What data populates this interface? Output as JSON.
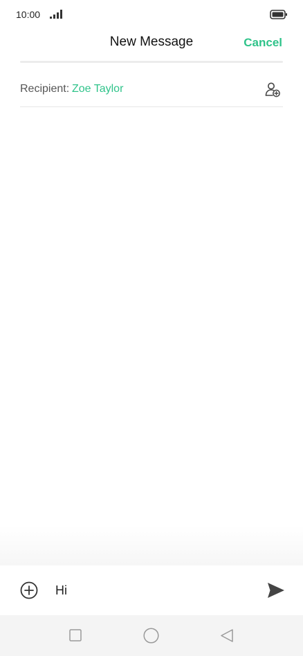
{
  "status_bar": {
    "time": "10:00",
    "signal_icon": "signal-bars-icon",
    "battery_icon": "battery-icon"
  },
  "header": {
    "title": "New Message",
    "cancel_label": "Cancel"
  },
  "recipient": {
    "label": "Recipient:",
    "name": "Zoe Taylor",
    "add_icon": "add-contact-icon"
  },
  "compose": {
    "attach_icon": "plus-circle-icon",
    "message_value": "Hi",
    "send_icon": "send-icon"
  },
  "nav": {
    "recents_icon": "square-icon",
    "home_icon": "circle-icon",
    "back_icon": "triangle-back-icon"
  },
  "colors": {
    "accent": "#2fc38a",
    "text": "#111111",
    "muted": "#555555",
    "nav_bg": "#f4f4f4"
  }
}
